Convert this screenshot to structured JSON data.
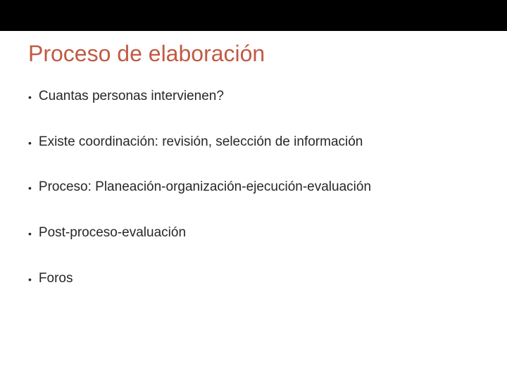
{
  "slide": {
    "title": "Proceso de elaboración",
    "bullets": [
      "Cuantas personas intervienen?",
      "Existe coordinación: revisión, selección de información",
      "Proceso: Planeación-organización-ejecución-evaluación",
      "Post-proceso-evaluación",
      "Foros"
    ]
  }
}
